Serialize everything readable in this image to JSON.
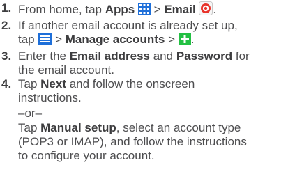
{
  "steps": [
    {
      "number": "1.",
      "parts": {
        "a": "From home, tap ",
        "apps": "Apps",
        "sep1": " > ",
        "email": "Email"
      },
      "icons": [
        "apps-grid-icon",
        "email-app-icon"
      ]
    },
    {
      "number": "2.",
      "parts": {
        "a": "If another email account is already set up,",
        "b": "tap ",
        "sep1": " > ",
        "manage": "Manage accounts",
        "sep2": " > "
      },
      "icons": [
        "menu-icon",
        "add-icon"
      ]
    },
    {
      "number": "3.",
      "parts": {
        "a": "Enter the ",
        "email_address": "Email address",
        "and": " and ",
        "password": "Password",
        "for": " for",
        "b": "the email account."
      }
    },
    {
      "number": "4.",
      "parts": {
        "a": "Tap ",
        "next": "Next",
        "b": " and follow the onscreen",
        "c": "instructions.",
        "or": "–or–",
        "tap": "Tap ",
        "manual": "Manual setup",
        "d": ", select an account type",
        "e": "(POP3 or IMAP), and follow the instructions",
        "f": "to configure your account."
      }
    }
  ],
  "colors": {
    "text": "#4d4d4f",
    "accent_blue": "#1e6fd9",
    "accent_green": "#23c043",
    "email_red": "#e8332a"
  }
}
